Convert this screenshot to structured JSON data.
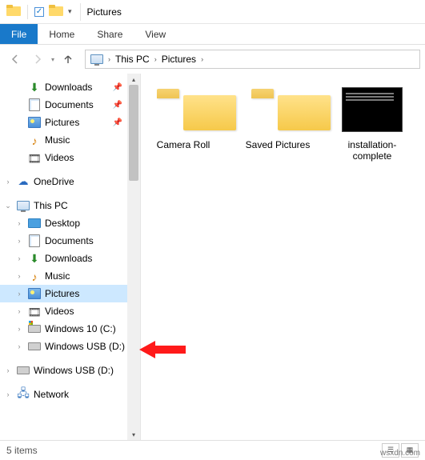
{
  "window": {
    "title": "Pictures"
  },
  "ribbon": {
    "file": "File",
    "home": "Home",
    "share": "Share",
    "view": "View"
  },
  "breadcrumb": {
    "root": "This PC",
    "current": "Pictures"
  },
  "nav": {
    "quick_access": [
      {
        "label": "Downloads",
        "key": "downloads",
        "pinned": true
      },
      {
        "label": "Documents",
        "key": "documents",
        "pinned": true
      },
      {
        "label": "Pictures",
        "key": "pictures",
        "pinned": true
      },
      {
        "label": "Music",
        "key": "music",
        "pinned": false
      },
      {
        "label": "Videos",
        "key": "videos",
        "pinned": false
      }
    ],
    "onedrive": "OneDrive",
    "this_pc": "This PC",
    "this_pc_items": [
      {
        "label": "Desktop",
        "key": "desktop"
      },
      {
        "label": "Documents",
        "key": "documents"
      },
      {
        "label": "Downloads",
        "key": "downloads"
      },
      {
        "label": "Music",
        "key": "music"
      },
      {
        "label": "Pictures",
        "key": "pictures",
        "selected": true
      },
      {
        "label": "Videos",
        "key": "videos"
      },
      {
        "label": "Windows 10 (C:)",
        "key": "drive-c"
      },
      {
        "label": "Windows USB (D:)",
        "key": "drive-d"
      }
    ],
    "removable": "Windows USB (D:)",
    "network": "Network"
  },
  "content": {
    "items": [
      {
        "label": "Camera Roll",
        "type": "folder"
      },
      {
        "label": "Saved Pictures",
        "type": "folder"
      },
      {
        "label": "installation-complete",
        "type": "image"
      }
    ]
  },
  "status": {
    "count": "5 items"
  },
  "watermark": "wsxdn.com"
}
